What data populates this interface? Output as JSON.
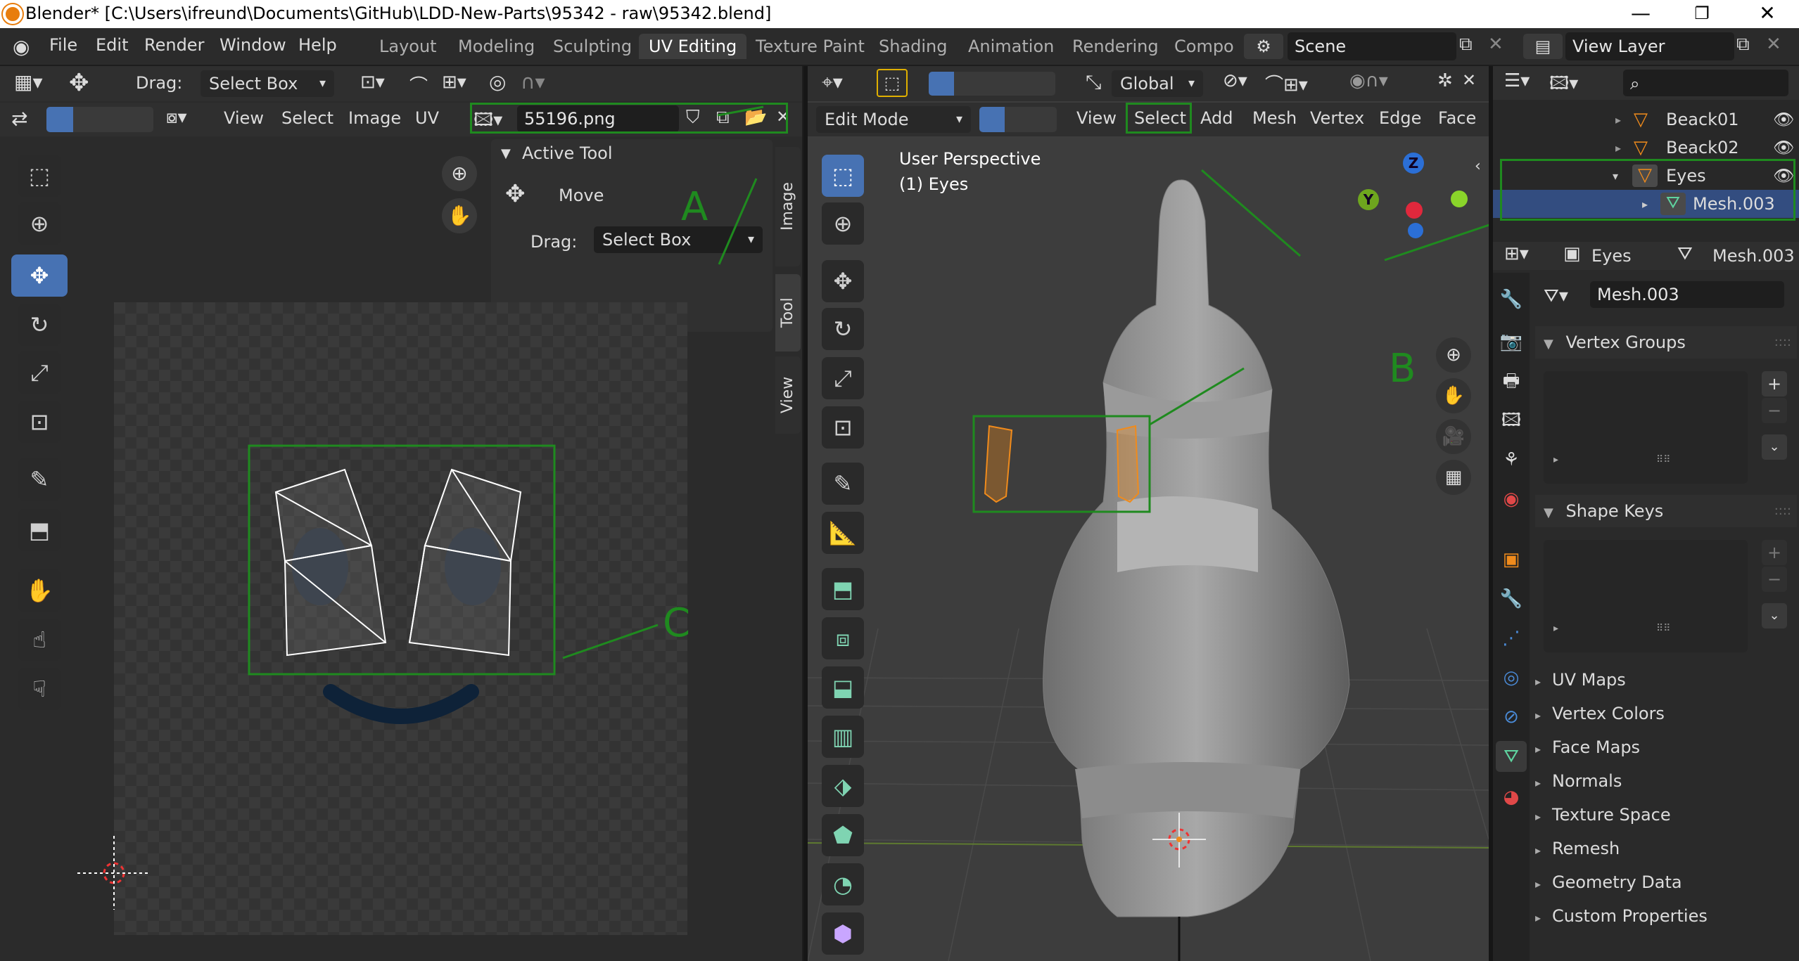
{
  "titlebar": {
    "title": "Blender* [C:\\Users\\ifreund\\Documents\\GitHub\\LDD-New-Parts\\95342 - raw\\95342.blend]",
    "minimize": "—",
    "maximize": "❐",
    "close": "✕"
  },
  "menus": [
    "File",
    "Edit",
    "Render",
    "Window",
    "Help"
  ],
  "workspaces": [
    "Layout",
    "Modeling",
    "Sculpting",
    "UV Editing",
    "Texture Paint",
    "Shading",
    "Animation",
    "Rendering",
    "Compo"
  ],
  "scene": {
    "label": "Scene",
    "view_layer": "View Layer"
  },
  "uv_editor": {
    "drag_label": "Drag:",
    "drag_value": "Select Box",
    "menus": [
      "View",
      "Select",
      "Image",
      "UV"
    ],
    "image_name": "55196.png",
    "side_tabs": [
      "Image",
      "Tool",
      "View"
    ],
    "active_tool": {
      "title": "Active Tool",
      "tool": "Move",
      "drag_label": "Drag:",
      "drag_value": "Select Box"
    }
  },
  "viewport": {
    "orientation": "Global",
    "mode": "Edit Mode",
    "menus": [
      "View",
      "Select",
      "Add",
      "Mesh",
      "Vertex",
      "Edge",
      "Face"
    ],
    "overlay_line1": "User Perspective",
    "overlay_line2": "(1) Eyes",
    "gizmo": {
      "z": "Z",
      "y": "Y"
    }
  },
  "outliner": {
    "items": [
      {
        "label": "Beack01",
        "type": "object"
      },
      {
        "label": "Beack02",
        "type": "object"
      },
      {
        "label": "Eyes",
        "type": "object"
      },
      {
        "label": "Mesh.003",
        "type": "mesh"
      }
    ]
  },
  "properties": {
    "breadcrumb_object": "Eyes",
    "breadcrumb_data": "Mesh.003",
    "datablock": "Mesh.003",
    "sections": [
      {
        "label": "Vertex Groups",
        "open": true
      },
      {
        "label": "Shape Keys",
        "open": true
      },
      {
        "label": "UV Maps",
        "open": false
      },
      {
        "label": "Vertex Colors",
        "open": false
      },
      {
        "label": "Face Maps",
        "open": false
      },
      {
        "label": "Normals",
        "open": false
      },
      {
        "label": "Texture Space",
        "open": false
      },
      {
        "label": "Remesh",
        "open": false
      },
      {
        "label": "Geometry Data",
        "open": false
      },
      {
        "label": "Custom Properties",
        "open": false
      }
    ]
  },
  "annotations": {
    "a": "A",
    "b": "B",
    "c": "C"
  },
  "colors": {
    "highlight": "#1f8a1f",
    "active_tab": "#4772b3",
    "selection": "#f08b1c"
  }
}
